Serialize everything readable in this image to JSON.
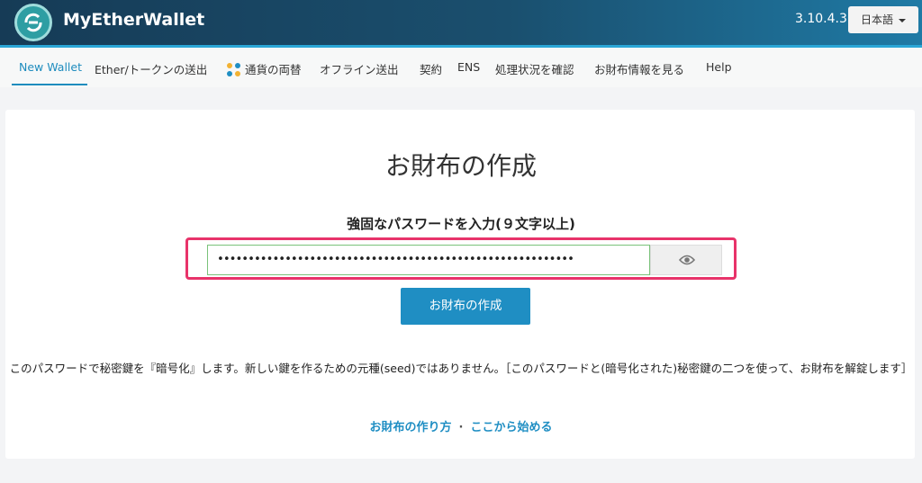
{
  "header": {
    "brand": "MyEtherWallet",
    "version": "3.10.4.3",
    "language": "日本語"
  },
  "nav": {
    "items": [
      {
        "label": "New Wallet",
        "active": true
      },
      {
        "label": "Ether/トークンの送出"
      },
      {
        "label": "通貨の両替",
        "icon": "swap-icon"
      },
      {
        "label": "オフライン送出"
      },
      {
        "label": "契約"
      },
      {
        "label": "ENS"
      },
      {
        "label": "処理状況を確認"
      },
      {
        "label": "お財布情報を見る"
      },
      {
        "label": "Help"
      }
    ]
  },
  "main": {
    "title": "お財布の作成",
    "password_label": "強固なパスワードを入力(９文字以上)",
    "password_value": "••••••••••••••••••••••••••••••••••••••••••••••••••••••••••",
    "show_password_icon": "eye-icon",
    "create_button": "お財布の作成",
    "notice": "このパスワードで秘密鍵を『暗号化』します。新しい鍵を作るための元種(seed)ではありません。［このパスワードと(暗号化された)秘密鍵の二つを使って、お財布を解錠します］",
    "link_howto": "お財布の作り方",
    "link_separator": "·",
    "link_start": "ここから始める"
  },
  "colors": {
    "accent": "#1f8ec3",
    "highlight_border": "#e8336a",
    "header_dark": "#163b56"
  }
}
